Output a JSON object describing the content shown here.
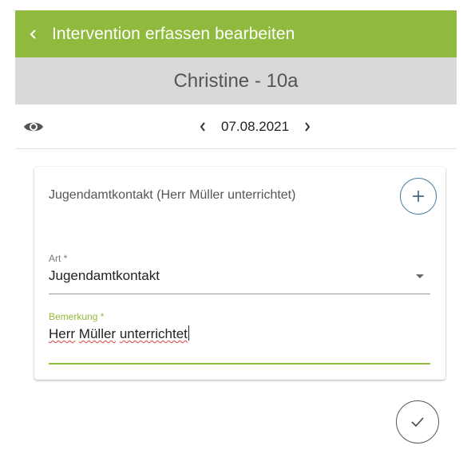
{
  "header": {
    "title": "Intervention erfassen bearbeiten",
    "back_icon": "chevron-left-icon",
    "background_color": "#8fba3d"
  },
  "student": {
    "name": "Christine - 10a"
  },
  "date_nav": {
    "date": "07.08.2021",
    "prev_icon": "chevron-left-icon",
    "next_icon": "chevron-right-icon",
    "visibility_icon": "eye-icon"
  },
  "card": {
    "title": "Jugendamtkontakt (Herr Müller unterrichtet)",
    "add_icon": "plus-icon",
    "fields": {
      "art": {
        "label": "Art *",
        "value": "Jugendamtkontakt"
      },
      "bemerkung": {
        "label": "Bemerkung *",
        "value_part1": "Herr",
        "value_part2": "Müller",
        "value_part3": "unterrichtet"
      }
    }
  },
  "save": {
    "icon": "check-icon"
  }
}
